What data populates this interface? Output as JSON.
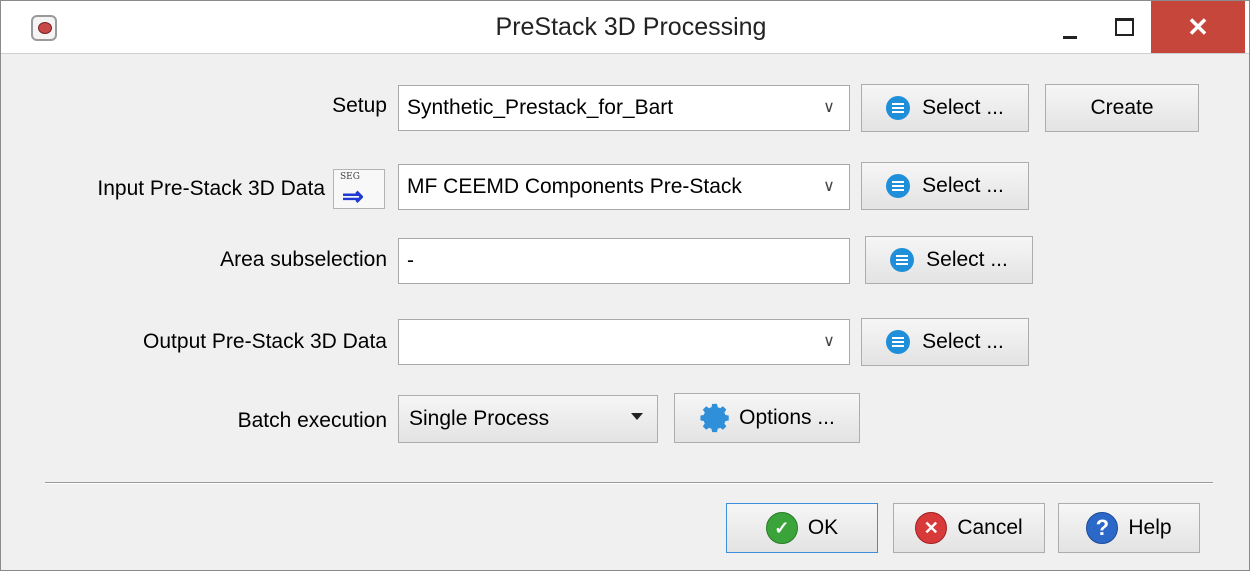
{
  "window": {
    "title": "PreStack 3D Processing",
    "close_glyph": "✕"
  },
  "form": {
    "setup": {
      "label": "Setup",
      "value": "Synthetic_Prestack_for_Bart",
      "select_label": "Select ...",
      "create_label": "Create"
    },
    "input": {
      "label": "Input Pre-Stack 3D Data",
      "icon_caption": "SEG",
      "value": "MF CEEMD Components Pre-Stack",
      "select_label": "Select ..."
    },
    "area": {
      "label": "Area subselection",
      "value": "-",
      "select_label": "Select ..."
    },
    "output": {
      "label": "Output Pre-Stack 3D Data",
      "value": "",
      "select_label": "Select ..."
    },
    "batch": {
      "label": "Batch execution",
      "value": "Single Process",
      "options_label": "Options ..."
    }
  },
  "footer": {
    "ok_label": "OK",
    "cancel_label": "Cancel",
    "help_label": "Help"
  },
  "icons": {
    "app": "app-logo-icon",
    "list": "list-icon",
    "segy": "segy-import-icon",
    "gear": "gear-icon",
    "ok": "check-icon",
    "cancel": "x-circle-icon",
    "help": "question-icon"
  },
  "colors": {
    "close_button": "#c7463b",
    "accent_blue": "#1f8fd9",
    "ok_green": "#3aa43a",
    "cancel_red": "#d83a3a",
    "help_blue": "#2c68c8"
  }
}
